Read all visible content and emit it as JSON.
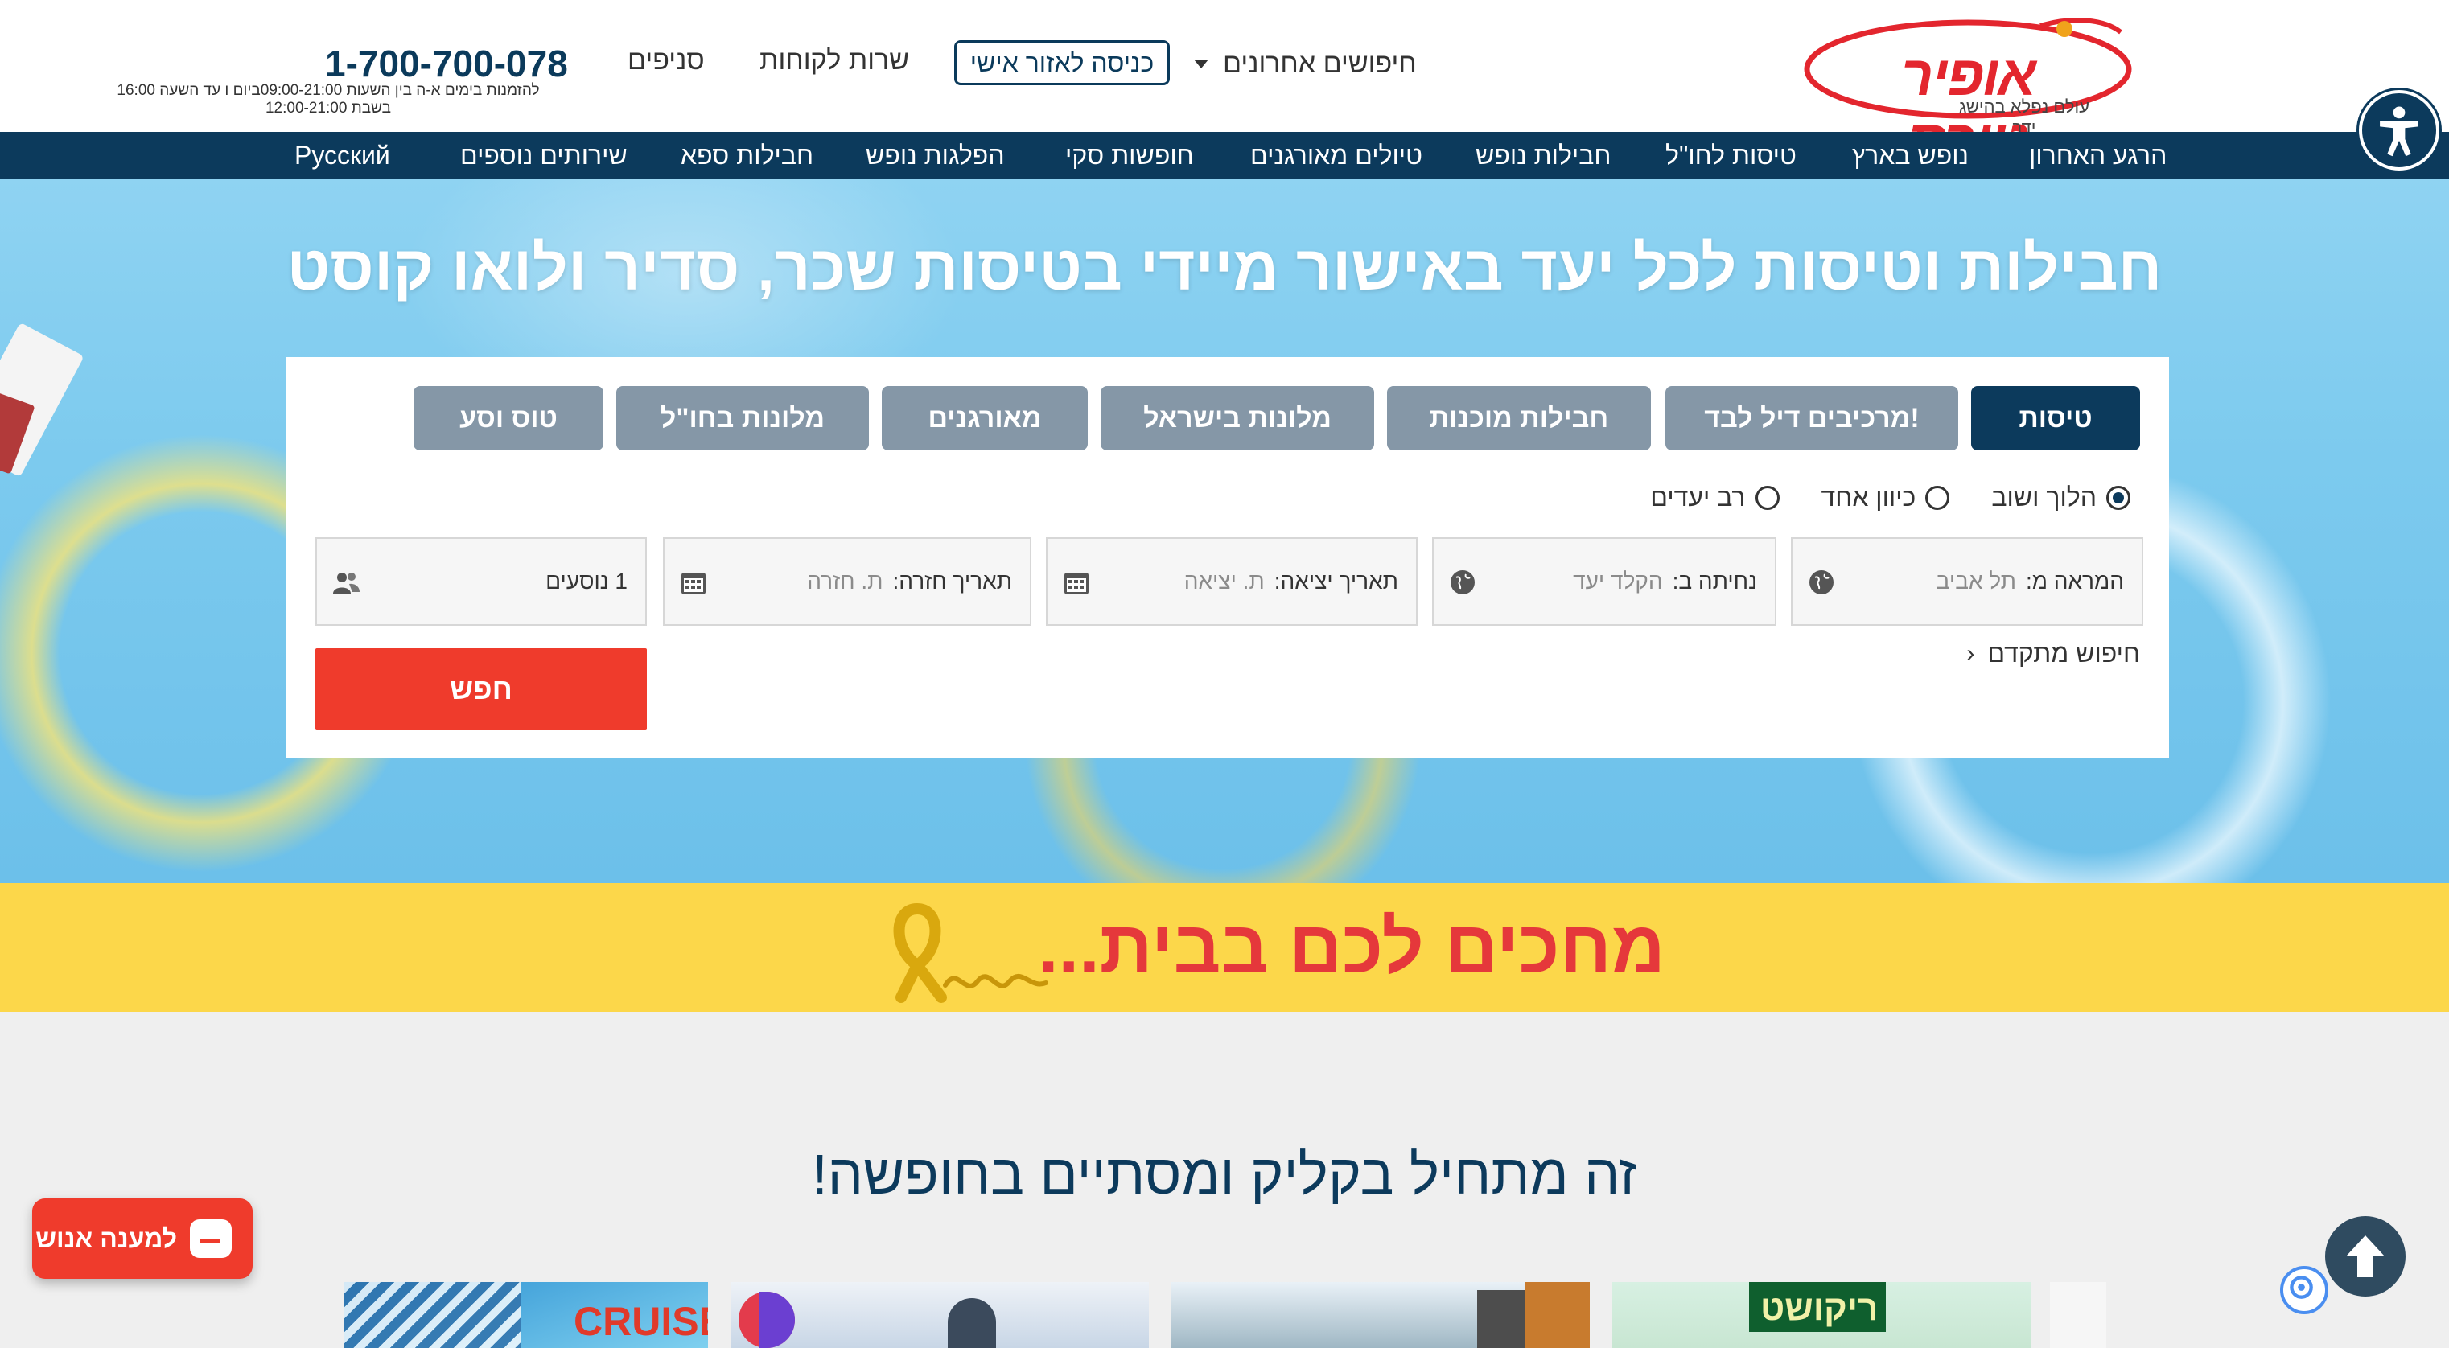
{
  "header": {
    "logo": {
      "name": "אופיר טורס",
      "tagline": "עולם נפלא בהישג ידך"
    },
    "recent_searches_label": "חיפושים אחרונים",
    "personal_area_label": "כניסה לאזור אישי",
    "customer_service_label": "שרות לקוחות",
    "branches_label": "סניפים",
    "phone": "1-700-700-078",
    "phone_note_line1": "להזמנות בימים א-ה בין השעות 09:00-21:00ביום ו עד השעה 16:00",
    "phone_note_line2": "בשבת 12:00-21:00"
  },
  "nav": {
    "items": [
      "הרגע האחרון",
      "נופש בארץ",
      "טיסות לחו\"ל",
      "חבילות נופש",
      "טיולים מאורגנים",
      "חופשות סקי",
      "הפלגות נופש",
      "חבילות ספא",
      "שירותים נוספים",
      "Русский"
    ]
  },
  "hero": {
    "title": "חבילות וטיסות לכל יעד באישור מיידי בטיסות שכר, סדיר ולואו קוסט"
  },
  "search": {
    "tabs": [
      "טיסות",
      "מרכיבים דיל לבד!",
      "חבילות מוכנות",
      "מלונות בישראל",
      "מאורגנים",
      "מלונות בחו\"ל",
      "טוס וסע"
    ],
    "trip_types": [
      "הלוך ושוב",
      "כיוון אחד",
      "רב יעדים"
    ],
    "selected_trip_type": "הלוך ושוב",
    "from_label": "המראה מ:",
    "from_value": "תל אביב",
    "to_label": "נחיתה ב:",
    "to_placeholder": "הקלד יעד",
    "depart_label": "תאריך יציאה:",
    "depart_placeholder": "ת. יציאה",
    "return_label": "תאריך חזרה:",
    "return_placeholder": "ת. חזרה",
    "passengers_value": "1 נוסעים",
    "advanced_label": "חיפוש מתקדם",
    "search_button": "חפש"
  },
  "banner": {
    "text": "מחכים לכם בבית..."
  },
  "main": {
    "section_title": "זה מתחיל בקליק ומסתיים בחופשה!",
    "cards": [
      {
        "label": "CRUISE",
        "color": "#e03a2a"
      },
      {
        "label": "ריקושט",
        "color": "#0f5f2e"
      }
    ]
  },
  "widgets": {
    "chat_label": "למענה אנוש"
  },
  "colors": {
    "brand_navy": "#0c3a5c",
    "brand_red": "#ef3b2c",
    "tab_inactive": "#8597a7",
    "banner_yellow": "#fcd74a"
  }
}
